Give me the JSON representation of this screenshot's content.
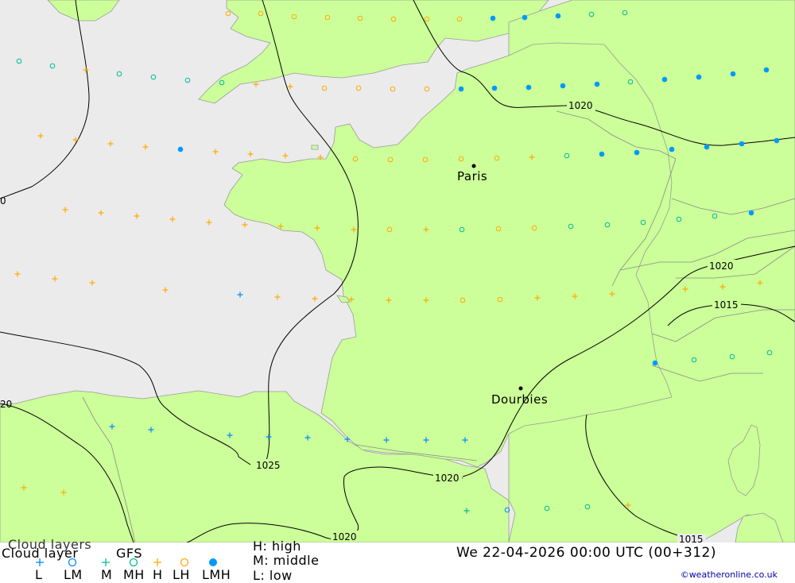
{
  "map": {
    "cities": [
      {
        "name": "Paris"
      },
      {
        "name": "Dourbies"
      }
    ],
    "isobars": [
      "1025",
      "1020",
      "1020",
      "1020",
      "1020",
      "1020",
      "1015",
      "1015",
      "0",
      "20"
    ]
  },
  "legend": {
    "title_line1": "Cloud layers",
    "title_line2": "Cloud layer",
    "model": "GFS",
    "symbol_codes": [
      "L",
      "LM",
      "M",
      "MH",
      "H",
      "LH",
      "LMH"
    ],
    "levels": {
      "high": "H: high",
      "middle": "M: middle",
      "low": "L: low"
    },
    "datetime": "We 22-04-2026 00:00 UTC (00+312)",
    "credit": "©weatheronline.co.uk"
  },
  "colors": {
    "land": "#ccff99",
    "sea": "#ebebeb",
    "low": "#0088ff",
    "middle": "#00bb99",
    "high": "#ffaa00",
    "combined": "#0099ff"
  }
}
